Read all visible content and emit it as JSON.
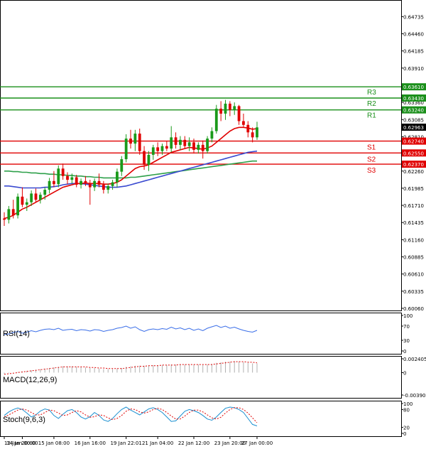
{
  "chart_data": {
    "type": "candlestick",
    "main": {
      "y_ticks": [
        "0.64735",
        "0.64460",
        "0.64185",
        "0.63910",
        "0.63635",
        "0.63360",
        "0.63085",
        "0.62810",
        "0.62535",
        "0.62260",
        "0.61985",
        "0.61710",
        "0.61435",
        "0.61160",
        "0.60885",
        "0.60610",
        "0.60335",
        "0.60060"
      ],
      "ylim": [
        0.6006,
        0.6491
      ],
      "current_price": "0.62963",
      "levels": [
        {
          "name": "R3",
          "value": "0.63610",
          "kind": "resistance",
          "color": "#1a8f1a"
        },
        {
          "name": "R2",
          "value": "0.63430",
          "kind": "resistance",
          "color": "#1a8f1a"
        },
        {
          "name": "R1",
          "value": "0.63240",
          "kind": "resistance",
          "color": "#1a8f1a"
        },
        {
          "name": "S1",
          "value": "0.62740",
          "kind": "support",
          "color": "#e00000"
        },
        {
          "name": "S2",
          "value": "0.62550",
          "kind": "support",
          "color": "#e00000"
        },
        {
          "name": "S3",
          "value": "0.62370",
          "kind": "support",
          "color": "#e00000"
        }
      ],
      "colors": {
        "up": "#1a9a1a",
        "down": "#e00000",
        "ma_fast": "#e00000",
        "ma_mid": "#3a4ad0",
        "ma_slow": "#2ea04a"
      },
      "candles": [
        [
          0.615,
          0.616,
          0.6138,
          0.6148
        ],
        [
          0.6148,
          0.617,
          0.6142,
          0.6165
        ],
        [
          0.6165,
          0.618,
          0.615,
          0.6155
        ],
        [
          0.6155,
          0.619,
          0.615,
          0.6185
        ],
        [
          0.6185,
          0.62,
          0.6168,
          0.6172
        ],
        [
          0.6172,
          0.6182,
          0.6162,
          0.6176
        ],
        [
          0.6176,
          0.6195,
          0.617,
          0.619
        ],
        [
          0.619,
          0.6198,
          0.6176,
          0.618
        ],
        [
          0.618,
          0.6192,
          0.6174,
          0.6188
        ],
        [
          0.6188,
          0.62,
          0.618,
          0.6196
        ],
        [
          0.6196,
          0.6215,
          0.619,
          0.621
        ],
        [
          0.621,
          0.6226,
          0.62,
          0.6205
        ],
        [
          0.6205,
          0.6235,
          0.62,
          0.623
        ],
        [
          0.623,
          0.6238,
          0.6212,
          0.6218
        ],
        [
          0.6218,
          0.6224,
          0.6205,
          0.6212
        ],
        [
          0.6212,
          0.6222,
          0.6206,
          0.6216
        ],
        [
          0.6216,
          0.622,
          0.62,
          0.6204
        ],
        [
          0.6204,
          0.6214,
          0.6198,
          0.621
        ],
        [
          0.621,
          0.6218,
          0.6202,
          0.6206
        ],
        [
          0.6206,
          0.6212,
          0.6172,
          0.62
        ],
        [
          0.62,
          0.6214,
          0.6194,
          0.621
        ],
        [
          0.621,
          0.6222,
          0.62,
          0.6204
        ],
        [
          0.6204,
          0.621,
          0.619,
          0.6196
        ],
        [
          0.6196,
          0.6206,
          0.619,
          0.6202
        ],
        [
          0.6202,
          0.6212,
          0.6196,
          0.6208
        ],
        [
          0.6208,
          0.623,
          0.62,
          0.6225
        ],
        [
          0.6225,
          0.625,
          0.6218,
          0.6245
        ],
        [
          0.6245,
          0.6285,
          0.624,
          0.6278
        ],
        [
          0.6278,
          0.6292,
          0.6262,
          0.627
        ],
        [
          0.627,
          0.6292,
          0.6258,
          0.6286
        ],
        [
          0.6286,
          0.6294,
          0.6252,
          0.6258
        ],
        [
          0.6258,
          0.6266,
          0.6228,
          0.6236
        ],
        [
          0.6236,
          0.6258,
          0.6226,
          0.6252
        ],
        [
          0.6252,
          0.6268,
          0.6244,
          0.6264
        ],
        [
          0.6264,
          0.6272,
          0.625,
          0.6258
        ],
        [
          0.6258,
          0.627,
          0.6252,
          0.6266
        ],
        [
          0.6266,
          0.6274,
          0.6258,
          0.6262
        ],
        [
          0.6262,
          0.6298,
          0.6256,
          0.628
        ],
        [
          0.628,
          0.6288,
          0.6262,
          0.6268
        ],
        [
          0.6268,
          0.6282,
          0.626,
          0.6276
        ],
        [
          0.6276,
          0.6282,
          0.6262,
          0.6266
        ],
        [
          0.6266,
          0.628,
          0.6258,
          0.6272
        ],
        [
          0.6272,
          0.6278,
          0.6254,
          0.626
        ],
        [
          0.626,
          0.6272,
          0.6254,
          0.6268
        ],
        [
          0.6268,
          0.6275,
          0.6246,
          0.6258
        ],
        [
          0.6258,
          0.6282,
          0.6254,
          0.6278
        ],
        [
          0.6278,
          0.6296,
          0.6272,
          0.629
        ],
        [
          0.629,
          0.6332,
          0.6286,
          0.6326
        ],
        [
          0.6326,
          0.6338,
          0.6306,
          0.6318
        ],
        [
          0.6318,
          0.634,
          0.6308,
          0.6334
        ],
        [
          0.6334,
          0.6338,
          0.6314,
          0.6324
        ],
        [
          0.6324,
          0.6336,
          0.6316,
          0.633
        ],
        [
          0.633,
          0.6332,
          0.63,
          0.6306
        ],
        [
          0.6306,
          0.6318,
          0.6296,
          0.63
        ],
        [
          0.63,
          0.6306,
          0.628,
          0.6288
        ],
        [
          0.6288,
          0.6296,
          0.6272,
          0.628
        ],
        [
          0.628,
          0.6305,
          0.6276,
          0.6296
        ]
      ],
      "ma_fast": [
        0.615,
        0.6152,
        0.6155,
        0.616,
        0.6165,
        0.6168,
        0.6172,
        0.6176,
        0.618,
        0.6184,
        0.6188,
        0.6192,
        0.6196,
        0.62,
        0.6202,
        0.6204,
        0.6206,
        0.6206,
        0.6207,
        0.6206,
        0.6206,
        0.6206,
        0.6205,
        0.6205,
        0.6206,
        0.6208,
        0.6212,
        0.6218,
        0.6224,
        0.623,
        0.6233,
        0.6234,
        0.6236,
        0.624,
        0.6244,
        0.6248,
        0.6252,
        0.6256,
        0.6258,
        0.626,
        0.6262,
        0.6264,
        0.6263,
        0.6262,
        0.6261,
        0.6263,
        0.6266,
        0.6272,
        0.6278,
        0.6284,
        0.629,
        0.6294,
        0.6296,
        0.6296,
        0.6295,
        0.6293,
        0.6294
      ],
      "ma_mid": [
        0.6202,
        0.6202,
        0.6201,
        0.62,
        0.6199,
        0.6199,
        0.6199,
        0.6199,
        0.6199,
        0.62,
        0.62,
        0.6201,
        0.6202,
        0.6204,
        0.6205,
        0.6206,
        0.6206,
        0.6206,
        0.6205,
        0.6204,
        0.6203,
        0.6202,
        0.6201,
        0.62,
        0.62,
        0.62,
        0.6201,
        0.6202,
        0.6204,
        0.6206,
        0.6208,
        0.621,
        0.6212,
        0.6214,
        0.6216,
        0.6218,
        0.622,
        0.6222,
        0.6224,
        0.6226,
        0.6228,
        0.623,
        0.6232,
        0.6234,
        0.6236,
        0.6238,
        0.624,
        0.6242,
        0.6244,
        0.6246,
        0.6248,
        0.625,
        0.6252,
        0.6254,
        0.6256,
        0.6257,
        0.6258
      ],
      "ma_slow": [
        0.6226,
        0.6226,
        0.6225,
        0.6225,
        0.6224,
        0.6224,
        0.6223,
        0.6223,
        0.6222,
        0.6222,
        0.6221,
        0.6221,
        0.622,
        0.622,
        0.6219,
        0.6219,
        0.6218,
        0.6218,
        0.6217,
        0.6217,
        0.6216,
        0.6216,
        0.6215,
        0.6215,
        0.6215,
        0.6215,
        0.6215,
        0.6215,
        0.6216,
        0.6216,
        0.6217,
        0.6218,
        0.6219,
        0.622,
        0.6221,
        0.6222,
        0.6223,
        0.6224,
        0.6225,
        0.6226,
        0.6227,
        0.6228,
        0.6229,
        0.623,
        0.6231,
        0.6232,
        0.6233,
        0.6234,
        0.6235,
        0.6236,
        0.6237,
        0.6238,
        0.6239,
        0.624,
        0.6241,
        0.6242,
        0.6242
      ]
    },
    "rsi": {
      "label": "RSI(14)",
      "ticks": [
        "100",
        "70",
        "30",
        "0"
      ],
      "ylim": [
        0,
        100
      ],
      "color": "#3a6ee8",
      "values": [
        46,
        48,
        52,
        55,
        50,
        53,
        57,
        54,
        58,
        61,
        62,
        60,
        64,
        58,
        60,
        61,
        57,
        60,
        59,
        56,
        60,
        59,
        55,
        58,
        60,
        64,
        66,
        70,
        64,
        68,
        60,
        55,
        60,
        62,
        60,
        63,
        61,
        67,
        62,
        65,
        60,
        64,
        58,
        62,
        57,
        64,
        68,
        72,
        66,
        70,
        64,
        67,
        62,
        58,
        55,
        53,
        58
      ]
    },
    "macd": {
      "label": "MACD(12,26,9)",
      "ticks": [
        "0.002405",
        "0",
        "-0.003902"
      ],
      "ylim": [
        -0.003902,
        0.002405
      ],
      "color": "#b0b0b0",
      "signal_color": "#e00000",
      "values": [
        -0.0002,
        -0.0001,
        0.0,
        0.0001,
        0.0002,
        0.0003,
        0.0004,
        0.0005,
        0.0006,
        0.0007,
        0.0008,
        0.0009,
        0.001,
        0.0011,
        0.0011,
        0.0011,
        0.001,
        0.001,
        0.0009,
        0.0008,
        0.0008,
        0.0007,
        0.0006,
        0.0006,
        0.0006,
        0.0007,
        0.0008,
        0.001,
        0.0011,
        0.0012,
        0.0012,
        0.0012,
        0.0012,
        0.0013,
        0.0013,
        0.0013,
        0.0013,
        0.0014,
        0.0014,
        0.0014,
        0.0014,
        0.0014,
        0.0014,
        0.0014,
        0.0013,
        0.0014,
        0.0015,
        0.0017,
        0.0018,
        0.0019,
        0.0019,
        0.002,
        0.0019,
        0.0018,
        0.0017,
        0.0016,
        0.0016
      ],
      "signal": [
        -0.0003,
        -0.0002,
        -0.0001,
        0.0,
        0.0001,
        0.0002,
        0.0003,
        0.0004,
        0.0005,
        0.0006,
        0.0007,
        0.0008,
        0.0009,
        0.001,
        0.001,
        0.001,
        0.001,
        0.001,
        0.001,
        0.0009,
        0.0009,
        0.0008,
        0.0008,
        0.0007,
        0.0007,
        0.0007,
        0.0007,
        0.0008,
        0.0009,
        0.001,
        0.0011,
        0.0011,
        0.0012,
        0.0012,
        0.0012,
        0.0013,
        0.0013,
        0.0013,
        0.0013,
        0.0014,
        0.0014,
        0.0014,
        0.0014,
        0.0014,
        0.0014,
        0.0014,
        0.0014,
        0.0015,
        0.0016,
        0.0017,
        0.0018,
        0.0019,
        0.0019,
        0.0019,
        0.0018,
        0.0018,
        0.0017
      ]
    },
    "stoch": {
      "label": "Stoch(9,6,3)",
      "ticks": [
        "100",
        "80",
        "20",
        "0"
      ],
      "ylim": [
        0,
        100
      ],
      "k_color": "#1a8fd0",
      "d_color": "#e00000",
      "k": [
        60,
        72,
        80,
        85,
        80,
        68,
        55,
        62,
        75,
        82,
        78,
        60,
        50,
        64,
        76,
        80,
        70,
        55,
        48,
        56,
        70,
        60,
        45,
        40,
        50,
        66,
        80,
        88,
        78,
        70,
        62,
        72,
        82,
        86,
        80,
        70,
        55,
        40,
        42,
        58,
        74,
        80,
        76,
        70,
        60,
        48,
        44,
        55,
        70,
        84,
        88,
        86,
        80,
        70,
        50,
        30,
        25
      ],
      "d": [
        55,
        62,
        70,
        78,
        82,
        78,
        70,
        62,
        62,
        70,
        78,
        76,
        68,
        60,
        62,
        70,
        76,
        72,
        62,
        54,
        56,
        62,
        60,
        52,
        46,
        50,
        60,
        74,
        82,
        80,
        72,
        68,
        72,
        80,
        84,
        80,
        70,
        58,
        48,
        48,
        58,
        70,
        78,
        78,
        72,
        62,
        52,
        48,
        54,
        68,
        80,
        86,
        86,
        80,
        68,
        52,
        36
      ]
    },
    "x_ticks": [
      {
        "label": "13 Jan 20:00",
        "i": 0
      },
      {
        "label": "14 Jan 00:00",
        "i": 4
      },
      {
        "label": "15 Jan 08:00",
        "i": 11
      },
      {
        "label": "16 Jan 16:00",
        "i": 19
      },
      {
        "label": "19 Jan 22:01",
        "i": 27
      },
      {
        "label": "21 Jan 04:00",
        "i": 34
      },
      {
        "label": "22 Jan 12:00",
        "i": 42
      },
      {
        "label": "23 Jan 20:00",
        "i": 50
      },
      {
        "label": "27 Jan 00:00",
        "i": 56
      }
    ]
  }
}
